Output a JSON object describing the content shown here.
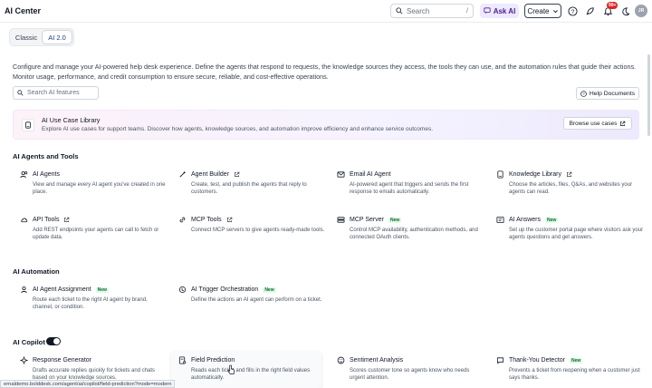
{
  "header": {
    "title": "AI Center",
    "search_placeholder": "Search",
    "search_shortcut": "/",
    "ask_ai": "Ask AI",
    "create": "Create",
    "notification_count": "99+",
    "avatar_initials": "JR"
  },
  "view_switch": {
    "options": [
      "Classic",
      "AI 2.0"
    ],
    "selected": "AI 2.0"
  },
  "intro": "Configure and manage your AI-powered help desk experience. Define the agents that respond to requests, the knowledge sources they access, the tools they can use, and the automation rules that guide their actions. Monitor usage, performance, and credit consumption to ensure secure, reliable, and cost-effective operations.",
  "feature_search_placeholder": "Search AI features",
  "help_documents": "Help Documents",
  "banner": {
    "title": "AI Use Case Library",
    "desc": "Explore AI use cases for support teams. Discover how agents, knowledge sources, and automation improve efficiency and enhance service outcomes.",
    "button": "Browse use cases"
  },
  "sections": {
    "agents_tools": {
      "title": "AI Agents and Tools",
      "cards": [
        {
          "title": "AI Agents",
          "desc": "View and manage every AI agent you've created in one place.",
          "icon": "users-icon",
          "external": false,
          "new": false
        },
        {
          "title": "Agent Builder",
          "desc": "Create, test, and publish the agents that reply to customers.",
          "icon": "wand-icon",
          "external": true,
          "new": false
        },
        {
          "title": "Email AI Agent",
          "desc": "AI-powered agent that triggers and sends the first response to emails automatically.",
          "icon": "mail-icon",
          "external": false,
          "new": false
        },
        {
          "title": "Knowledge Library",
          "desc": "Choose the articles, files, Q&As, and websites your agents can read.",
          "icon": "book-icon",
          "external": true,
          "new": false
        },
        {
          "title": "API Tools",
          "desc": "Add REST endpoints your agents can call to fetch or update data.",
          "icon": "cloud-icon",
          "external": true,
          "new": false
        },
        {
          "title": "MCP Tools",
          "desc": "Connect MCP servers to give agents ready-made tools.",
          "icon": "link-icon",
          "external": true,
          "new": false
        },
        {
          "title": "MCP Server",
          "desc": "Control MCP availability, authentication methods, and connected OAuth clients.",
          "icon": "server-icon",
          "external": false,
          "new": true
        },
        {
          "title": "AI Answers",
          "desc": "Set up the customer portal page where visitors ask your agents questions and get answers.",
          "icon": "answers-icon",
          "external": false,
          "new": true
        }
      ]
    },
    "automation": {
      "title": "AI Automation",
      "cards": [
        {
          "title": "AI Agent Assignment",
          "desc": "Route each ticket to the right AI agent by brand, channel, or condition.",
          "icon": "assign-icon",
          "external": false,
          "new": true
        },
        {
          "title": "AI Trigger Orchestration",
          "desc": "Define the actions an AI agent can perform on a ticket.",
          "icon": "trigger-icon",
          "external": false,
          "new": true
        }
      ]
    },
    "copilot": {
      "title": "AI Copilot",
      "toggle_on": true,
      "cards": [
        {
          "title": "Response Generator",
          "desc": "Drafts accurate replies quickly for tickets and chats based on your knowledge sources.",
          "icon": "sparkle-icon",
          "external": false,
          "new": false
        },
        {
          "title": "Field Prediction",
          "desc": "Reads each ticket and fills in the right field values automatically.",
          "icon": "field-icon",
          "external": false,
          "new": false
        },
        {
          "title": "Sentiment Analysis",
          "desc": "Scores customer tone so agents know who needs urgent attention.",
          "icon": "smile-icon",
          "external": false,
          "new": false
        },
        {
          "title": "Thank-You Detector",
          "desc": "Prevents a ticket from reopening when a customer just says thanks.",
          "icon": "thanks-icon",
          "external": false,
          "new": true
        }
      ]
    }
  },
  "new_label": "New",
  "status_url": "ernaldemo.bolddesk.com/agent/ai/copilot/field-prediction?mode=modern",
  "colors": {
    "accent": "#4c1d95",
    "badge": "#dc2626",
    "new_bg": "#dcfce7",
    "new_text": "#166534"
  }
}
